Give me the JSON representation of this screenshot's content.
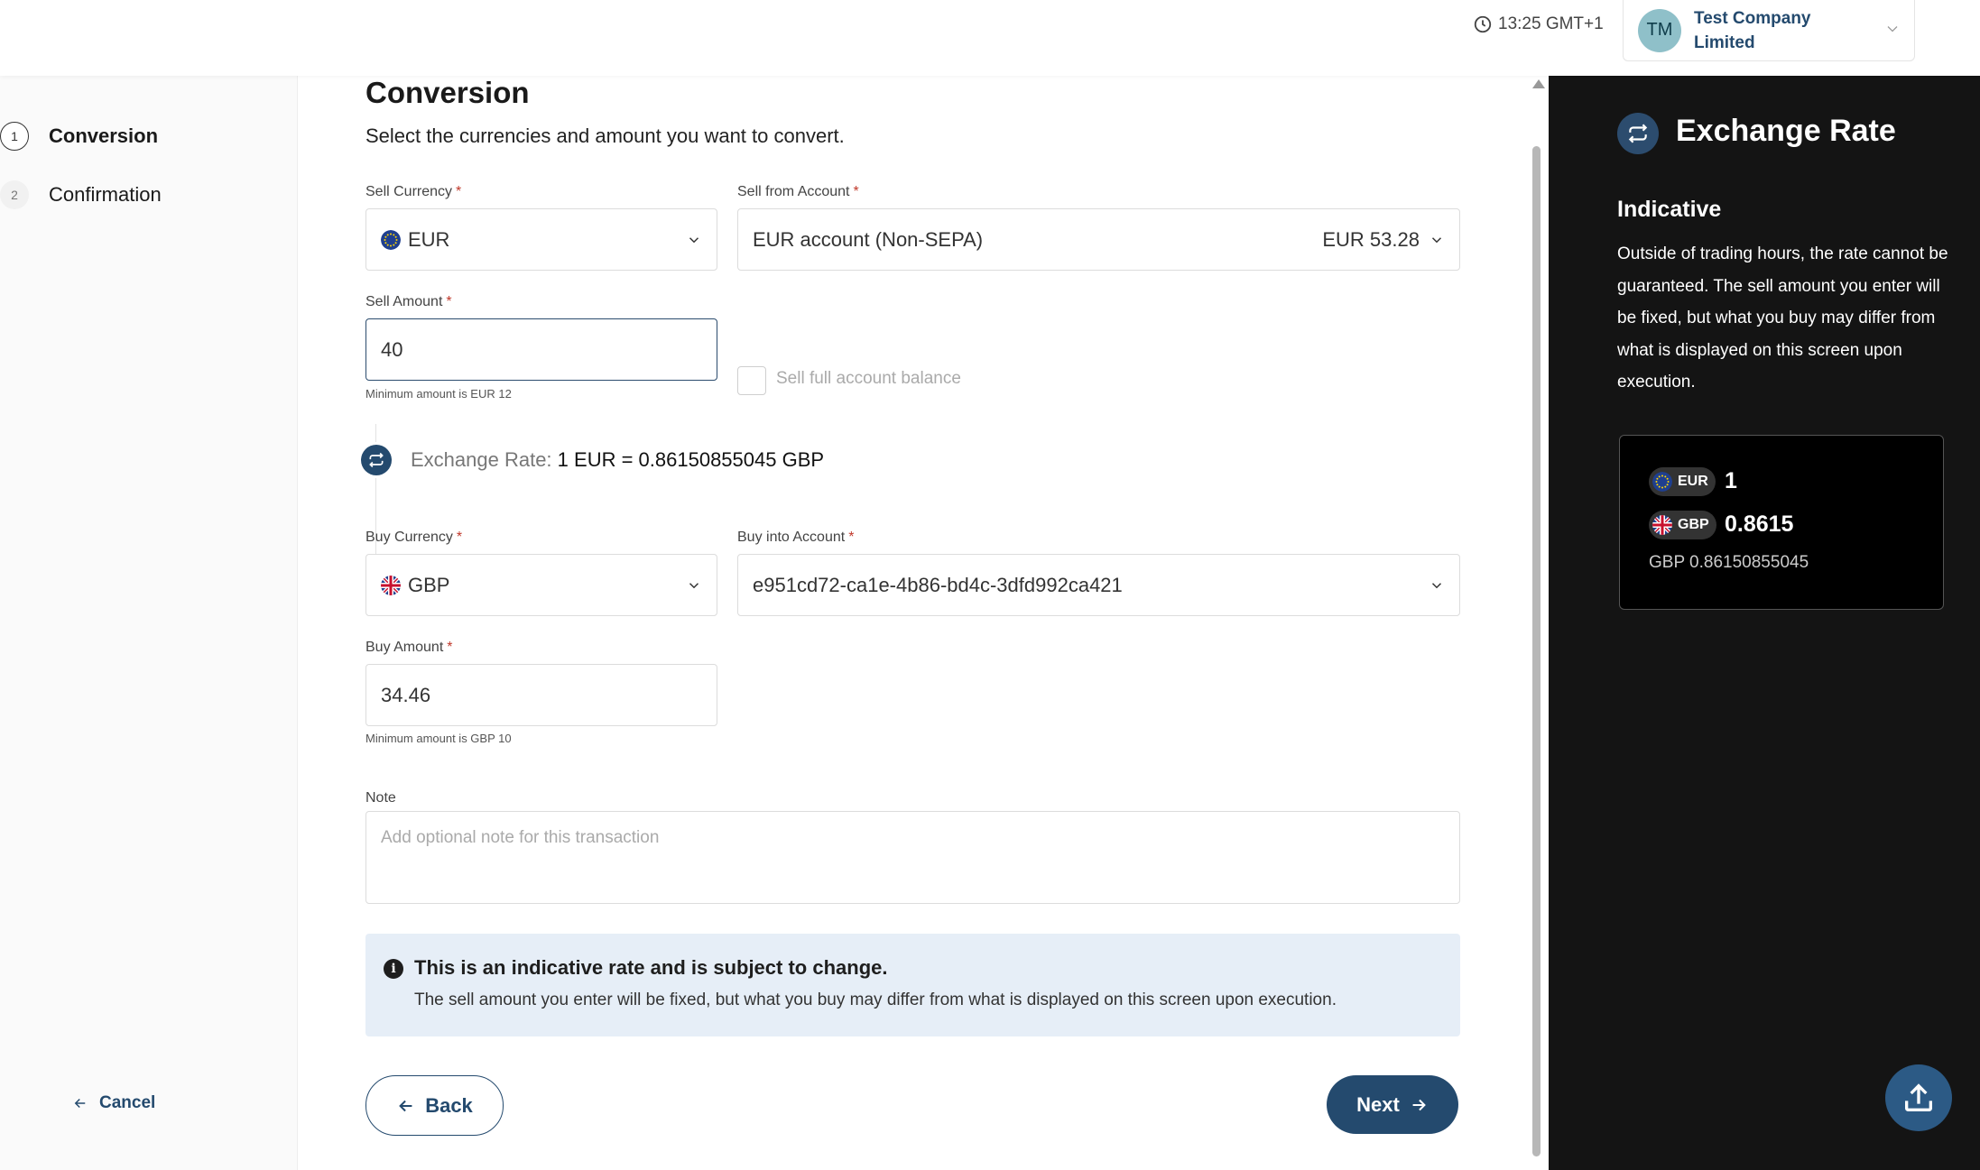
{
  "header": {
    "time": "13:25 GMT+1",
    "company_initials": "TM",
    "company_name": "Test Company Limited"
  },
  "sidebar": {
    "steps": [
      {
        "number": "1",
        "label": "Conversion"
      },
      {
        "number": "2",
        "label": "Confirmation"
      }
    ],
    "cancel_label": "Cancel"
  },
  "form": {
    "title": "Conversion",
    "subtitle": "Select the currencies and amount you want to convert.",
    "sell_currency_label": "Sell Currency",
    "sell_currency_value": "EUR",
    "sell_account_label": "Sell from Account",
    "sell_account_value": "EUR account (Non-SEPA)",
    "sell_account_balance": "EUR 53.28",
    "sell_amount_label": "Sell Amount",
    "sell_amount_value": "40",
    "sell_amount_hint": "Minimum amount is EUR 12",
    "sell_full_balance_label": "Sell full account balance",
    "exchange_rate_label": "Exchange Rate:",
    "exchange_rate_value": "1 EUR = 0.86150855045 GBP",
    "buy_currency_label": "Buy Currency",
    "buy_currency_value": "GBP",
    "buy_account_label": "Buy into Account",
    "buy_account_value": "e951cd72-ca1e-4b86-bd4c-3dfd992ca421",
    "buy_amount_label": "Buy Amount",
    "buy_amount_value": "34.46",
    "buy_amount_hint": "Minimum amount is GBP 10",
    "note_label": "Note",
    "note_placeholder": "Add optional note for this transaction",
    "required_mark": "*"
  },
  "alert": {
    "title": "This is an indicative rate and is subject to change.",
    "body": "The sell amount you enter will be fixed, but what you buy may differ from what is displayed on this screen upon execution."
  },
  "actions": {
    "back_label": "Back",
    "next_label": "Next"
  },
  "panel": {
    "title": "Exchange Rate",
    "subtitle": "Indicative",
    "text": "Outside of trading hours, the rate cannot be guaranteed. The sell amount you enter will be fixed, but what you buy may differ from what is displayed on this screen upon execution.",
    "sell_code": "EUR",
    "sell_value": "1",
    "buy_code": "GBP",
    "buy_value": "0.8615",
    "full_rate": "GBP 0.86150855045"
  },
  "colors": {
    "brand": "#244a6e",
    "panel_bg": "#141414",
    "alert_bg": "#e6eef7",
    "required": "#c0392b"
  },
  "icons": [
    "clock-icon",
    "chevron-down-icon",
    "arrow-left-icon",
    "arrow-right-icon",
    "swap-icon",
    "info-icon",
    "upload-icon",
    "eu-flag-icon",
    "uk-flag-icon"
  ]
}
